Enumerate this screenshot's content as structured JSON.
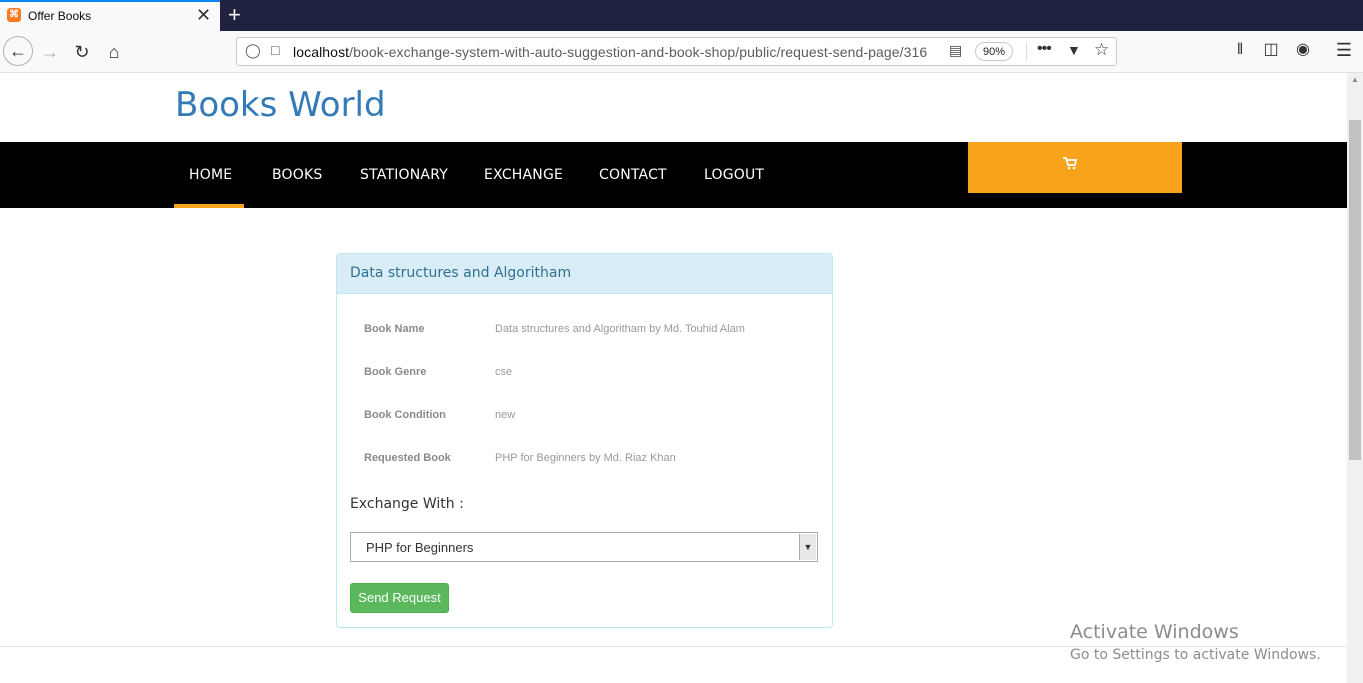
{
  "browser": {
    "tab_title": "Offer Books",
    "favicon_glyph": "⌘",
    "close_glyph": "✕",
    "new_tab_glyph": "+",
    "url_host": "localhost",
    "url_path": "/book-exchange-system-with-auto-suggestion-and-book-shop/public/request-send-page/316",
    "zoom": "90%"
  },
  "site": {
    "brand": "Books World",
    "nav": [
      "HOME",
      "BOOKS",
      "STATIONARY",
      "EXCHANGE",
      "CONTACT",
      "LOGOUT"
    ],
    "active_nav": "HOME",
    "accent_color": "#f9a21b"
  },
  "panel": {
    "heading": "Data structures and Algoritham",
    "rows": [
      {
        "label": "Book Name",
        "value": "Data structures and Algoritham by Md. Touhid Alam"
      },
      {
        "label": "Book Genre",
        "value": "cse"
      },
      {
        "label": "Book Condition",
        "value": "new"
      },
      {
        "label": "Requested Book",
        "value": "PHP for Beginners by Md. Riaz Khan"
      }
    ],
    "exchange_label": "Exchange With :",
    "select_value": "PHP for Beginners",
    "button_label": "Send Request"
  },
  "watermark": {
    "title": "Activate Windows",
    "subtitle": "Go to Settings to activate Windows."
  }
}
